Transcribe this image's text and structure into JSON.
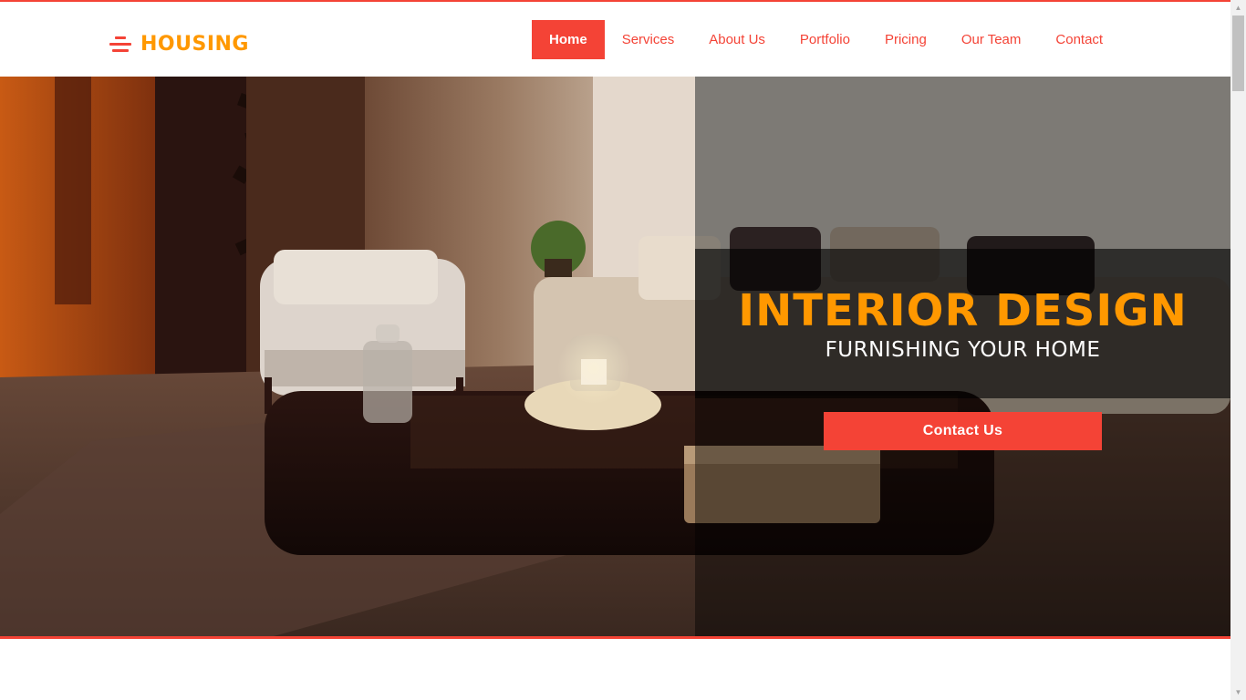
{
  "brand": {
    "name": "HOUSING",
    "icon": "stacked-bars-logo-icon",
    "name_color": "#ff9800",
    "accent_color": "#f44336"
  },
  "nav": {
    "items": [
      {
        "label": "Home",
        "active": true
      },
      {
        "label": "Services"
      },
      {
        "label": "About Us"
      },
      {
        "label": "Portfolio"
      },
      {
        "label": "Pricing"
      },
      {
        "label": "Our Team"
      },
      {
        "label": "Contact"
      }
    ]
  },
  "hero": {
    "title": "INTERIOR DESIGN",
    "subtitle": "FURNISHING YOUR HOME",
    "button_label": "Contact Us",
    "image_description_icon": "living-room-photo"
  },
  "scrollbar": {
    "up_icon": "arrow-up-icon",
    "down_icon": "arrow-down-icon"
  }
}
